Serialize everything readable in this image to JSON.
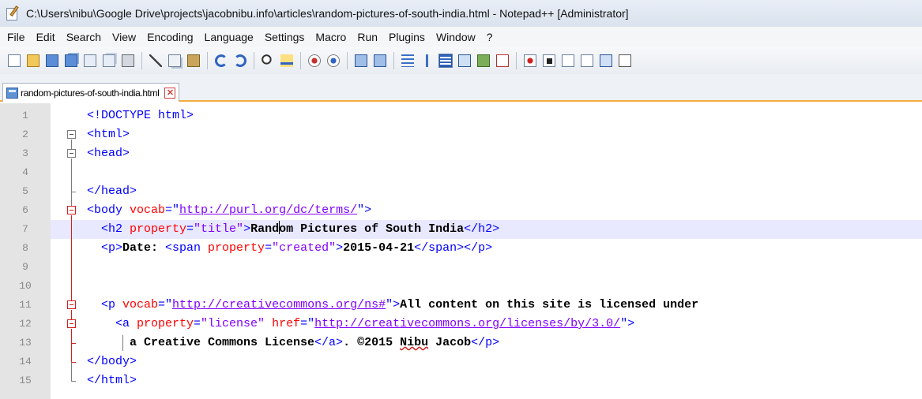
{
  "window": {
    "title": "C:\\Users\\nibu\\Google Drive\\projects\\jacobnibu.info\\articles\\random-pictures-of-south-india.html - Notepad++ [Administrator]"
  },
  "menu": [
    "File",
    "Edit",
    "Search",
    "View",
    "Encoding",
    "Language",
    "Settings",
    "Macro",
    "Run",
    "Plugins",
    "Window",
    "?"
  ],
  "toolbar": {
    "buttons": [
      "new-file",
      "open-file",
      "save",
      "save-all",
      "close",
      "close-all",
      "print",
      "cut",
      "copy",
      "paste",
      "undo",
      "redo",
      "find",
      "replace",
      "zoom-in",
      "zoom-out",
      "sync-vertical",
      "sync-horizontal",
      "word-wrap",
      "show-all-characters",
      "indent-guide",
      "user-defined-language",
      "document-map",
      "function-list",
      "macro-record",
      "macro-stop",
      "macro-play",
      "macro-run-multiple",
      "macro-save",
      "spell-check"
    ]
  },
  "tab": {
    "label": "random-pictures-of-south-india.html",
    "close_glyph": "✕"
  },
  "editor": {
    "current_line": 7,
    "lines": [
      {
        "n": "1",
        "segments": [
          {
            "t": "<!DOCTYPE html>",
            "c": "t-tag"
          }
        ]
      },
      {
        "n": "2",
        "segments": [
          {
            "t": "<html>",
            "c": "t-tag"
          }
        ]
      },
      {
        "n": "3",
        "segments": [
          {
            "t": "<head>",
            "c": "t-tag"
          }
        ]
      },
      {
        "n": "4",
        "segments": []
      },
      {
        "n": "5",
        "segments": [
          {
            "t": "</head>",
            "c": "t-tag"
          }
        ]
      },
      {
        "n": "6",
        "segments": [
          {
            "t": "<body ",
            "c": "t-tag"
          },
          {
            "t": "vocab",
            "c": "t-attr"
          },
          {
            "t": "=\"",
            "c": "t-tag"
          },
          {
            "t": "http://purl.org/dc/terms/",
            "c": "t-url"
          },
          {
            "t": "\">",
            "c": "t-tag"
          }
        ]
      },
      {
        "n": "7",
        "segments": [
          {
            "t": "  <h2 ",
            "c": "t-tag"
          },
          {
            "t": "property",
            "c": "t-attr"
          },
          {
            "t": "=",
            "c": "t-tag"
          },
          {
            "t": "\"title\"",
            "c": "t-val"
          },
          {
            "t": ">",
            "c": "t-tag"
          },
          {
            "t": "Rand",
            "c": "t-bold"
          },
          {
            "t": "",
            "c": "caret"
          },
          {
            "t": "om Pictures of South India",
            "c": "t-bold"
          },
          {
            "t": "</h2>",
            "c": "t-tag"
          }
        ]
      },
      {
        "n": "8",
        "segments": [
          {
            "t": "  <p>",
            "c": "t-tag"
          },
          {
            "t": "Date: ",
            "c": "t-bold"
          },
          {
            "t": "<span ",
            "c": "t-tag"
          },
          {
            "t": "property",
            "c": "t-attr"
          },
          {
            "t": "=",
            "c": "t-tag"
          },
          {
            "t": "\"created\"",
            "c": "t-val"
          },
          {
            "t": ">",
            "c": "t-tag"
          },
          {
            "t": "2015-04-21",
            "c": "t-bold"
          },
          {
            "t": "</span></p>",
            "c": "t-tag"
          }
        ]
      },
      {
        "n": "9",
        "segments": []
      },
      {
        "n": "10",
        "segments": []
      },
      {
        "n": "11",
        "segments": [
          {
            "t": "  <p ",
            "c": "t-tag"
          },
          {
            "t": "vocab",
            "c": "t-attr"
          },
          {
            "t": "=\"",
            "c": "t-tag"
          },
          {
            "t": "http://creativecommons.org/ns#",
            "c": "t-url"
          },
          {
            "t": "\">",
            "c": "t-tag"
          },
          {
            "t": "All content on this site is licensed under",
            "c": "t-bold"
          }
        ]
      },
      {
        "n": "12",
        "segments": [
          {
            "t": "    <a ",
            "c": "t-tag"
          },
          {
            "t": "property",
            "c": "t-attr"
          },
          {
            "t": "=",
            "c": "t-tag"
          },
          {
            "t": "\"license\"",
            "c": "t-val"
          },
          {
            "t": " ",
            "c": ""
          },
          {
            "t": "href",
            "c": "t-attr"
          },
          {
            "t": "=\"",
            "c": "t-tag"
          },
          {
            "t": "http://creativecommons.org/licenses/by/3.0/",
            "c": "t-url"
          },
          {
            "t": "\">",
            "c": "t-tag"
          }
        ]
      },
      {
        "n": "13",
        "segments": [
          {
            "t": "      a Creative Commons License",
            "c": "t-bold"
          },
          {
            "t": "</a>",
            "c": "t-tag"
          },
          {
            "t": ". ©2015 ",
            "c": "t-bold"
          },
          {
            "t": "Nibu",
            "c": "t-bold t-squig"
          },
          {
            "t": " Jacob",
            "c": "t-bold"
          },
          {
            "t": "</p>",
            "c": "t-tag"
          }
        ]
      },
      {
        "n": "14",
        "segments": [
          {
            "t": "</body>",
            "c": "t-tag"
          }
        ]
      },
      {
        "n": "15",
        "segments": [
          {
            "t": "</html>",
            "c": "t-tag"
          }
        ]
      }
    ]
  }
}
